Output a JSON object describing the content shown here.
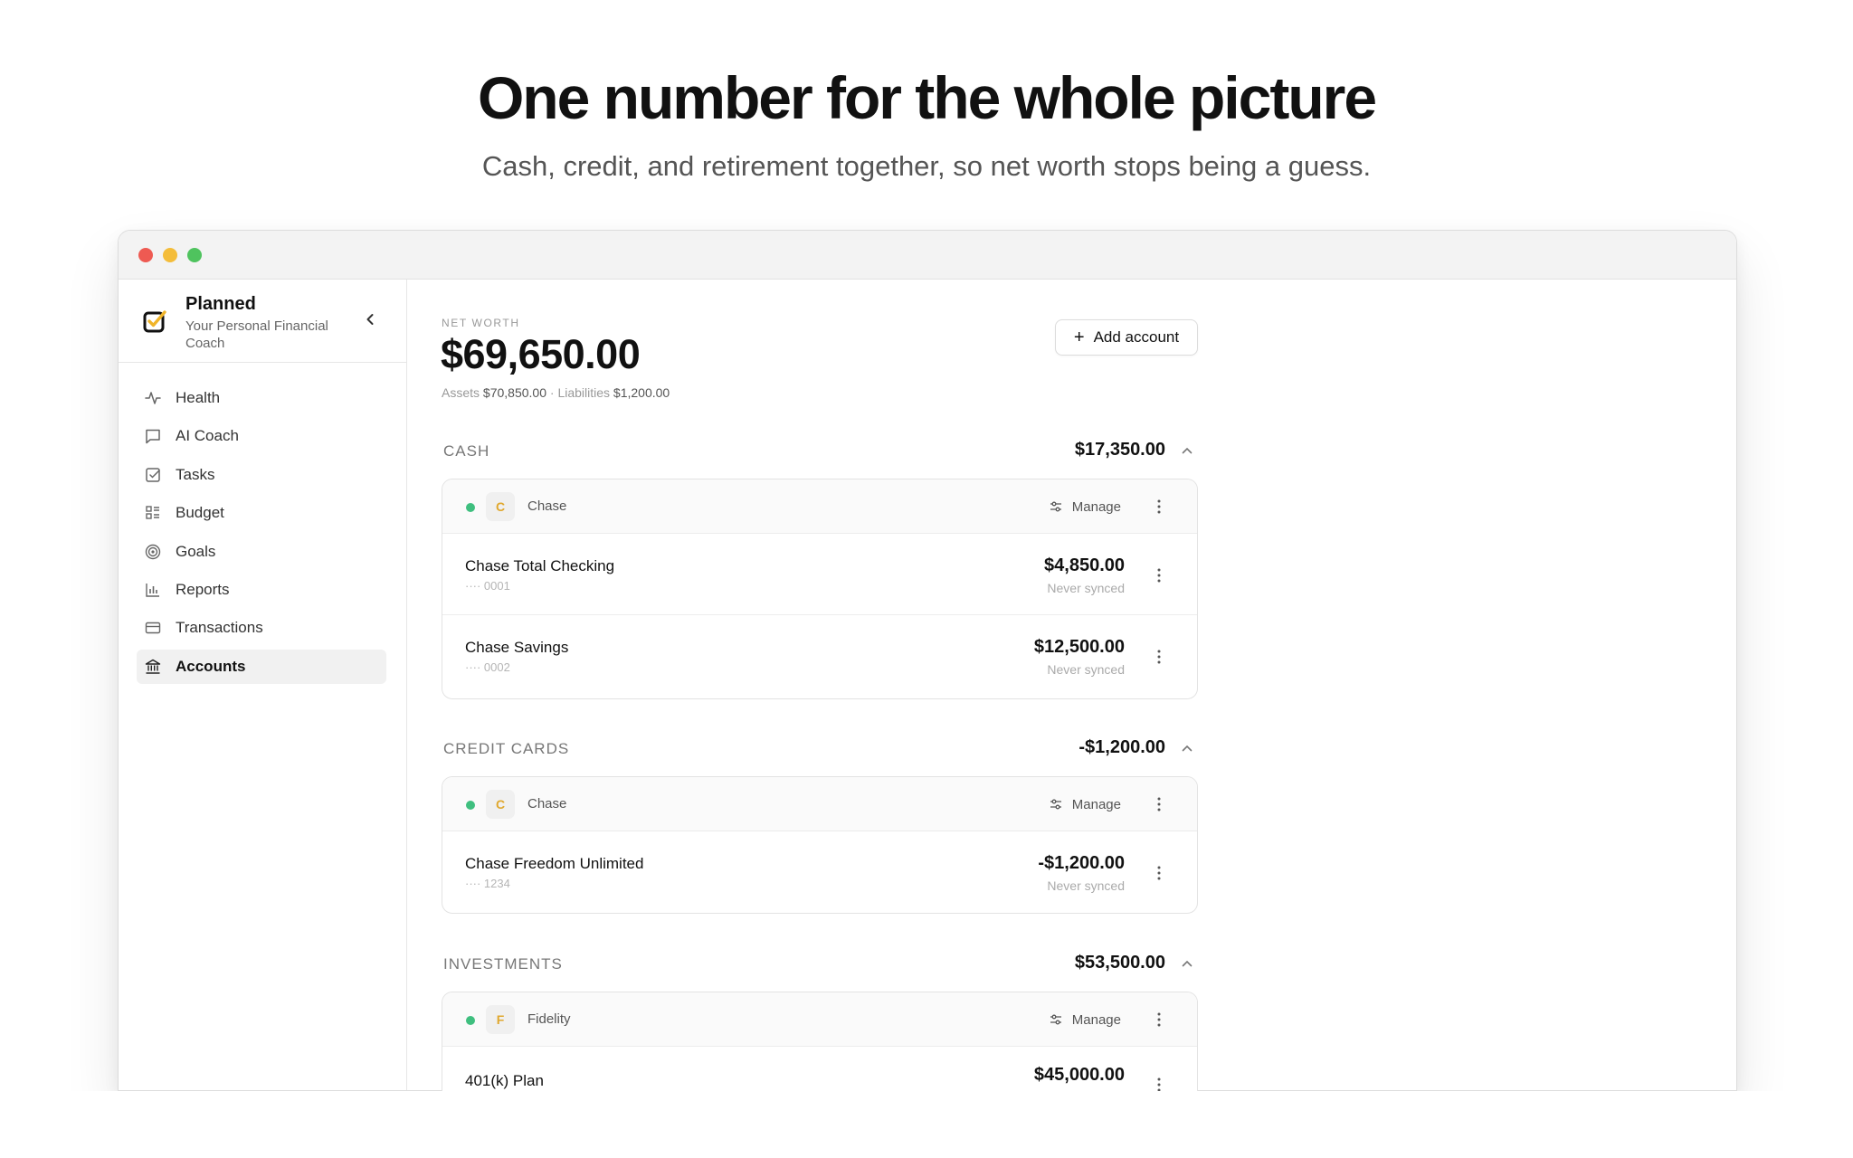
{
  "hero": {
    "title": "One number for the whole picture",
    "subtitle": "Cash, credit, and retirement together, so net worth stops being a guess."
  },
  "brand": {
    "name": "Planned",
    "tagline": "Your Personal Financial Coach"
  },
  "sidebar": {
    "items": [
      {
        "label": "Health",
        "icon": "activity-icon",
        "active": false
      },
      {
        "label": "AI Coach",
        "icon": "chat-icon",
        "active": false
      },
      {
        "label": "Tasks",
        "icon": "checkbox-icon",
        "active": false
      },
      {
        "label": "Budget",
        "icon": "budget-icon",
        "active": false
      },
      {
        "label": "Goals",
        "icon": "target-icon",
        "active": false
      },
      {
        "label": "Reports",
        "icon": "bar-chart-icon",
        "active": false
      },
      {
        "label": "Transactions",
        "icon": "credit-card-icon",
        "active": false
      },
      {
        "label": "Accounts",
        "icon": "bank-icon",
        "active": true
      }
    ]
  },
  "net_worth": {
    "label": "NET WORTH",
    "value": "$69,650.00",
    "assets_label": "Assets",
    "assets_value": "$70,850.00",
    "separator": "·",
    "liabilities_label": "Liabilities",
    "liabilities_value": "$1,200.00"
  },
  "add_account_label": "Add account",
  "sections": [
    {
      "title": "CASH",
      "total": "$17,350.00",
      "institution": {
        "avatar": "C",
        "name": "Chase",
        "manage_label": "Manage"
      },
      "accounts": [
        {
          "name": "Chase Total Checking",
          "mask": "···· 0001",
          "balance": "$4,850.00",
          "sync": "Never synced"
        },
        {
          "name": "Chase Savings",
          "mask": "···· 0002",
          "balance": "$12,500.00",
          "sync": "Never synced"
        }
      ]
    },
    {
      "title": "CREDIT CARDS",
      "total": "-$1,200.00",
      "institution": {
        "avatar": "C",
        "name": "Chase",
        "manage_label": "Manage"
      },
      "accounts": [
        {
          "name": "Chase Freedom Unlimited",
          "mask": "···· 1234",
          "balance": "-$1,200.00",
          "sync": "Never synced"
        }
      ]
    },
    {
      "title": "INVESTMENTS",
      "total": "$53,500.00",
      "institution": {
        "avatar": "F",
        "name": "Fidelity",
        "manage_label": "Manage"
      },
      "accounts": [
        {
          "name": "401(k) Plan",
          "mask": "",
          "balance": "$45,000.00",
          "sync": ""
        }
      ]
    }
  ],
  "colors": {
    "status_connected": "#3fbf7f",
    "avatar_letter": "#e0a82e",
    "window_close": "#ee5a52",
    "window_minimize": "#f4bd3a",
    "window_zoom": "#4fc35e"
  }
}
